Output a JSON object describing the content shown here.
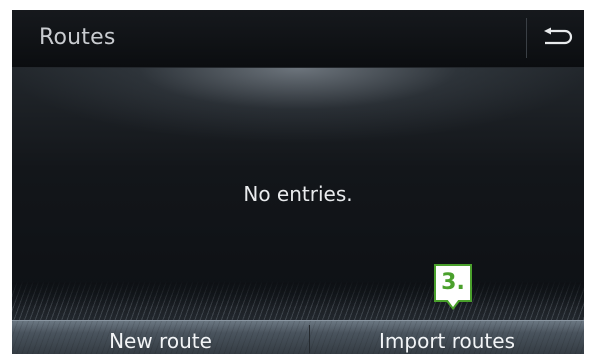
{
  "header": {
    "title": "Routes",
    "back_icon": "back-arrow-icon"
  },
  "content": {
    "empty_message": "No entries."
  },
  "bottom_bar": {
    "new_route_label": "New route",
    "import_routes_label": "Import routes"
  },
  "callout": {
    "label": "3.",
    "color": "#4aa02c"
  }
}
